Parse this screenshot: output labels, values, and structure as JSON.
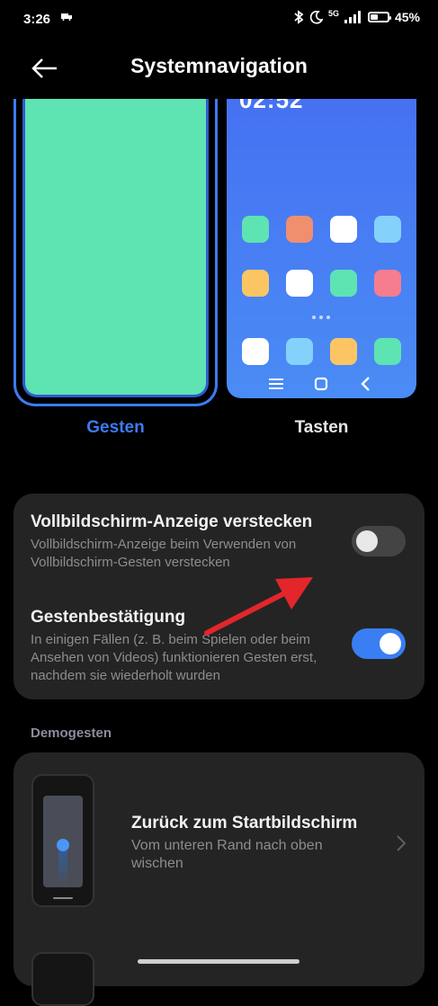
{
  "status_bar": {
    "time": "3:26",
    "network": "5G",
    "battery_text": "45%",
    "battery_level": 0.45
  },
  "header": {
    "title": "Systemnavigation"
  },
  "preview": {
    "right_clock": "02:52",
    "left_color": "#5ee3b3",
    "accent_color": "#3c7bf2",
    "app_colors": [
      "#5ee3b3",
      "#ef8f6d",
      "#ffffff",
      "#84d2fb",
      "#fbc564",
      "#ffffff",
      "#5ee3b3",
      "#f57d8e",
      "#ffffff",
      "#84d2fb",
      "#fbc564",
      "#5ee3b3"
    ]
  },
  "options": {
    "gesten_label": "Gesten",
    "tasten_label": "Tasten",
    "selected": "Gesten"
  },
  "settings": {
    "hide_indicator": {
      "title": "Vollbildschirm-Anzeige verstecken",
      "subtitle": "Vollbildschirm-Anzeige beim Verwenden von Vollbildschirm-Gesten verstecken",
      "enabled": false
    },
    "gesture_confirm": {
      "title": "Gestenbestätigung",
      "subtitle": "In einigen Fällen (z. B. beim Spielen oder beim Ansehen von Videos) funktionieren Gesten erst, nachdem sie wiederholt wurden",
      "enabled": true
    }
  },
  "demo": {
    "section_title": "Demogesten",
    "items": [
      {
        "title": "Zurück zum Startbildschirm",
        "subtitle": "Vom unteren Rand nach oben wischen"
      }
    ]
  },
  "icons": {
    "back": "arrow-left-icon",
    "bluetooth": "bluetooth-icon",
    "moon": "moon-icon",
    "signal": "signal-icon",
    "battery": "battery-icon",
    "chevron": "chevron-right-icon",
    "annotation": "red-arrow-annotation"
  }
}
